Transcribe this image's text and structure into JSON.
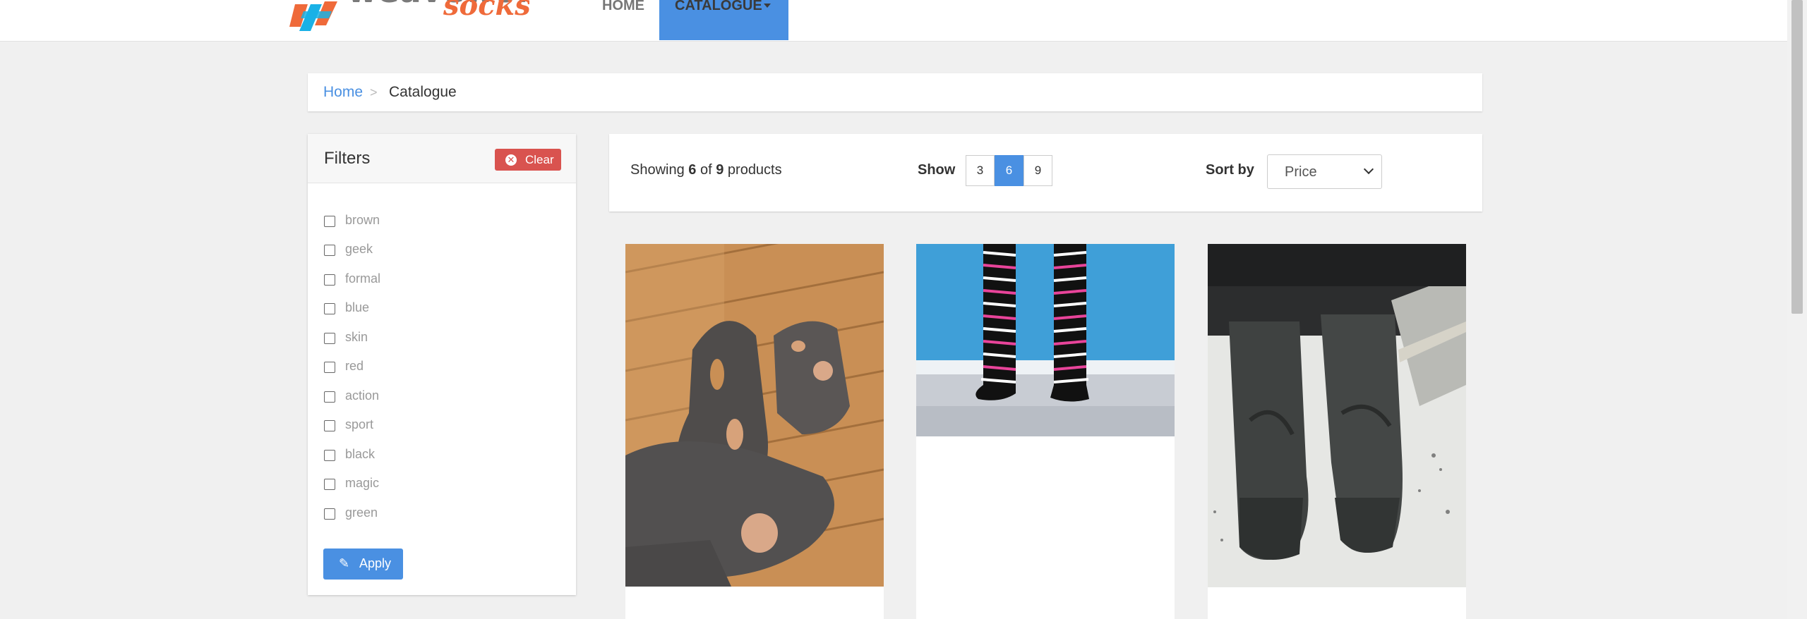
{
  "header": {
    "logo": {
      "word": "weaveworks",
      "sub": "socks"
    },
    "nav": [
      {
        "label": "HOME"
      },
      {
        "label": "CATALOGUE"
      }
    ]
  },
  "breadcrumb": {
    "home": "Home",
    "separator": ">",
    "current": "Catalogue"
  },
  "filters": {
    "title": "Filters",
    "clear_label": "Clear",
    "apply_label": "Apply",
    "items": [
      {
        "label": "brown",
        "checked": false
      },
      {
        "label": "geek",
        "checked": false
      },
      {
        "label": "formal",
        "checked": false
      },
      {
        "label": "blue",
        "checked": false
      },
      {
        "label": "skin",
        "checked": false
      },
      {
        "label": "red",
        "checked": false
      },
      {
        "label": "action",
        "checked": false
      },
      {
        "label": "sport",
        "checked": false
      },
      {
        "label": "black",
        "checked": false
      },
      {
        "label": "magic",
        "checked": false
      },
      {
        "label": "green",
        "checked": false
      }
    ]
  },
  "toolbar": {
    "showing_prefix": "Showing",
    "showing_count": "6",
    "showing_of": "of",
    "showing_total": "9",
    "showing_suffix": "products",
    "show_label": "Show",
    "page_sizes": [
      "3",
      "6",
      "9"
    ],
    "page_size_selected": "6",
    "sort_label": "Sort by",
    "sort_value": "Price"
  },
  "products": [
    {
      "image": "holey-grey-socks-photo"
    },
    {
      "image": "striped-pink-black-socks-photo"
    },
    {
      "image": "grey-puma-socks-photo"
    }
  ],
  "colors": {
    "accent": "#4a90e2",
    "danger": "#d9534f",
    "logo_orange": "#ef6a3a",
    "background": "#f0f0f0"
  }
}
